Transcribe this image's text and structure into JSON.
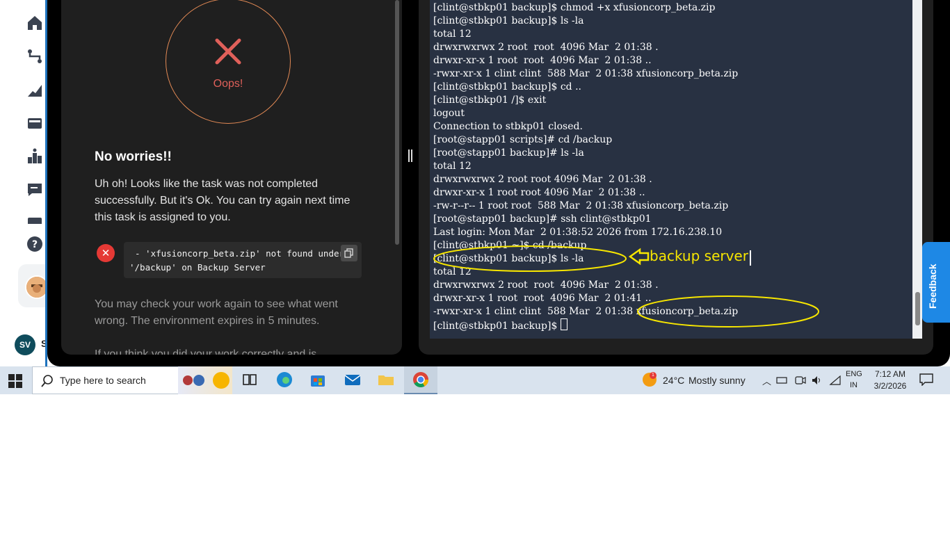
{
  "left_panel": {
    "status_text": "Oops!",
    "heading": "No worries!!",
    "message": "Uh oh! Looks like the task was not completed successfully. But it's Ok. You can try again next time this task is assigned to you.",
    "error_line1": "- 'xfusioncorp_beta.zip' not found under",
    "error_line2": "'/backup' on Backup Server",
    "check_message": "You may check your work again to see what went wrong. The environment expires in 5 minutes.",
    "cut_message": "If you think you did your work correctly and is"
  },
  "sidebar": {
    "user_initials": "SV",
    "user_extra": "S"
  },
  "terminal": {
    "lines": [
      "[clint@stbkp01 backup]$ chmod +x xfusioncorp_beta.zip",
      "[clint@stbkp01 backup]$ ls -la",
      "total 12",
      "drwxrwxrwx 2 root  root  4096 Mar  2 01:38 .",
      "drwxr-xr-x 1 root  root  4096 Mar  2 01:38 ..",
      "-rwxr-xr-x 1 clint clint  588 Mar  2 01:38 xfusioncorp_beta.zip",
      "[clint@stbkp01 backup]$ cd ..",
      "[clint@stbkp01 /]$ exit",
      "logout",
      "Connection to stbkp01 closed.",
      "[root@stapp01 scripts]# cd /backup",
      "[root@stapp01 backup]# ls -la",
      "total 12",
      "drwxrwxrwx 2 root root 4096 Mar  2 01:38 .",
      "drwxr-xr-x 1 root root 4096 Mar  2 01:38 ..",
      "-rw-r--r-- 1 root root  588 Mar  2 01:38 xfusioncorp_beta.zip",
      "[root@stapp01 backup]# ssh clint@stbkp01",
      "Last login: Mon Mar  2 01:38:52 2026 from 172.16.238.10",
      "[clint@stbkp01 ~]$ cd /backup",
      "[clint@stbkp01 backup]$ ls -la",
      "total 12",
      "drwxrwxrwx 2 root  root  4096 Mar  2 01:38 .",
      "drwxr-xr-x 1 root  root  4096 Mar  2 01:41 ..",
      "-rwxr-xr-x 1 clint clint  588 Mar  2 01:38 xfusioncorp_beta.zip",
      "[clint@stbkp01 backup]$ "
    ],
    "annotation_label": "backup server"
  },
  "feedback_label": "Feedback",
  "taskbar": {
    "search_placeholder": "Type here to search",
    "weather_badge": "1",
    "temperature": "24°C",
    "condition": "Mostly sunny",
    "language_line1": "ENG",
    "language_line2": "IN",
    "time": "7:12 AM",
    "date": "3/2/2026"
  },
  "colors": {
    "terminal_bg": "#283142",
    "annotation": "#f7e600",
    "error_red": "#e53935",
    "accent_blue": "#1e88e5"
  }
}
